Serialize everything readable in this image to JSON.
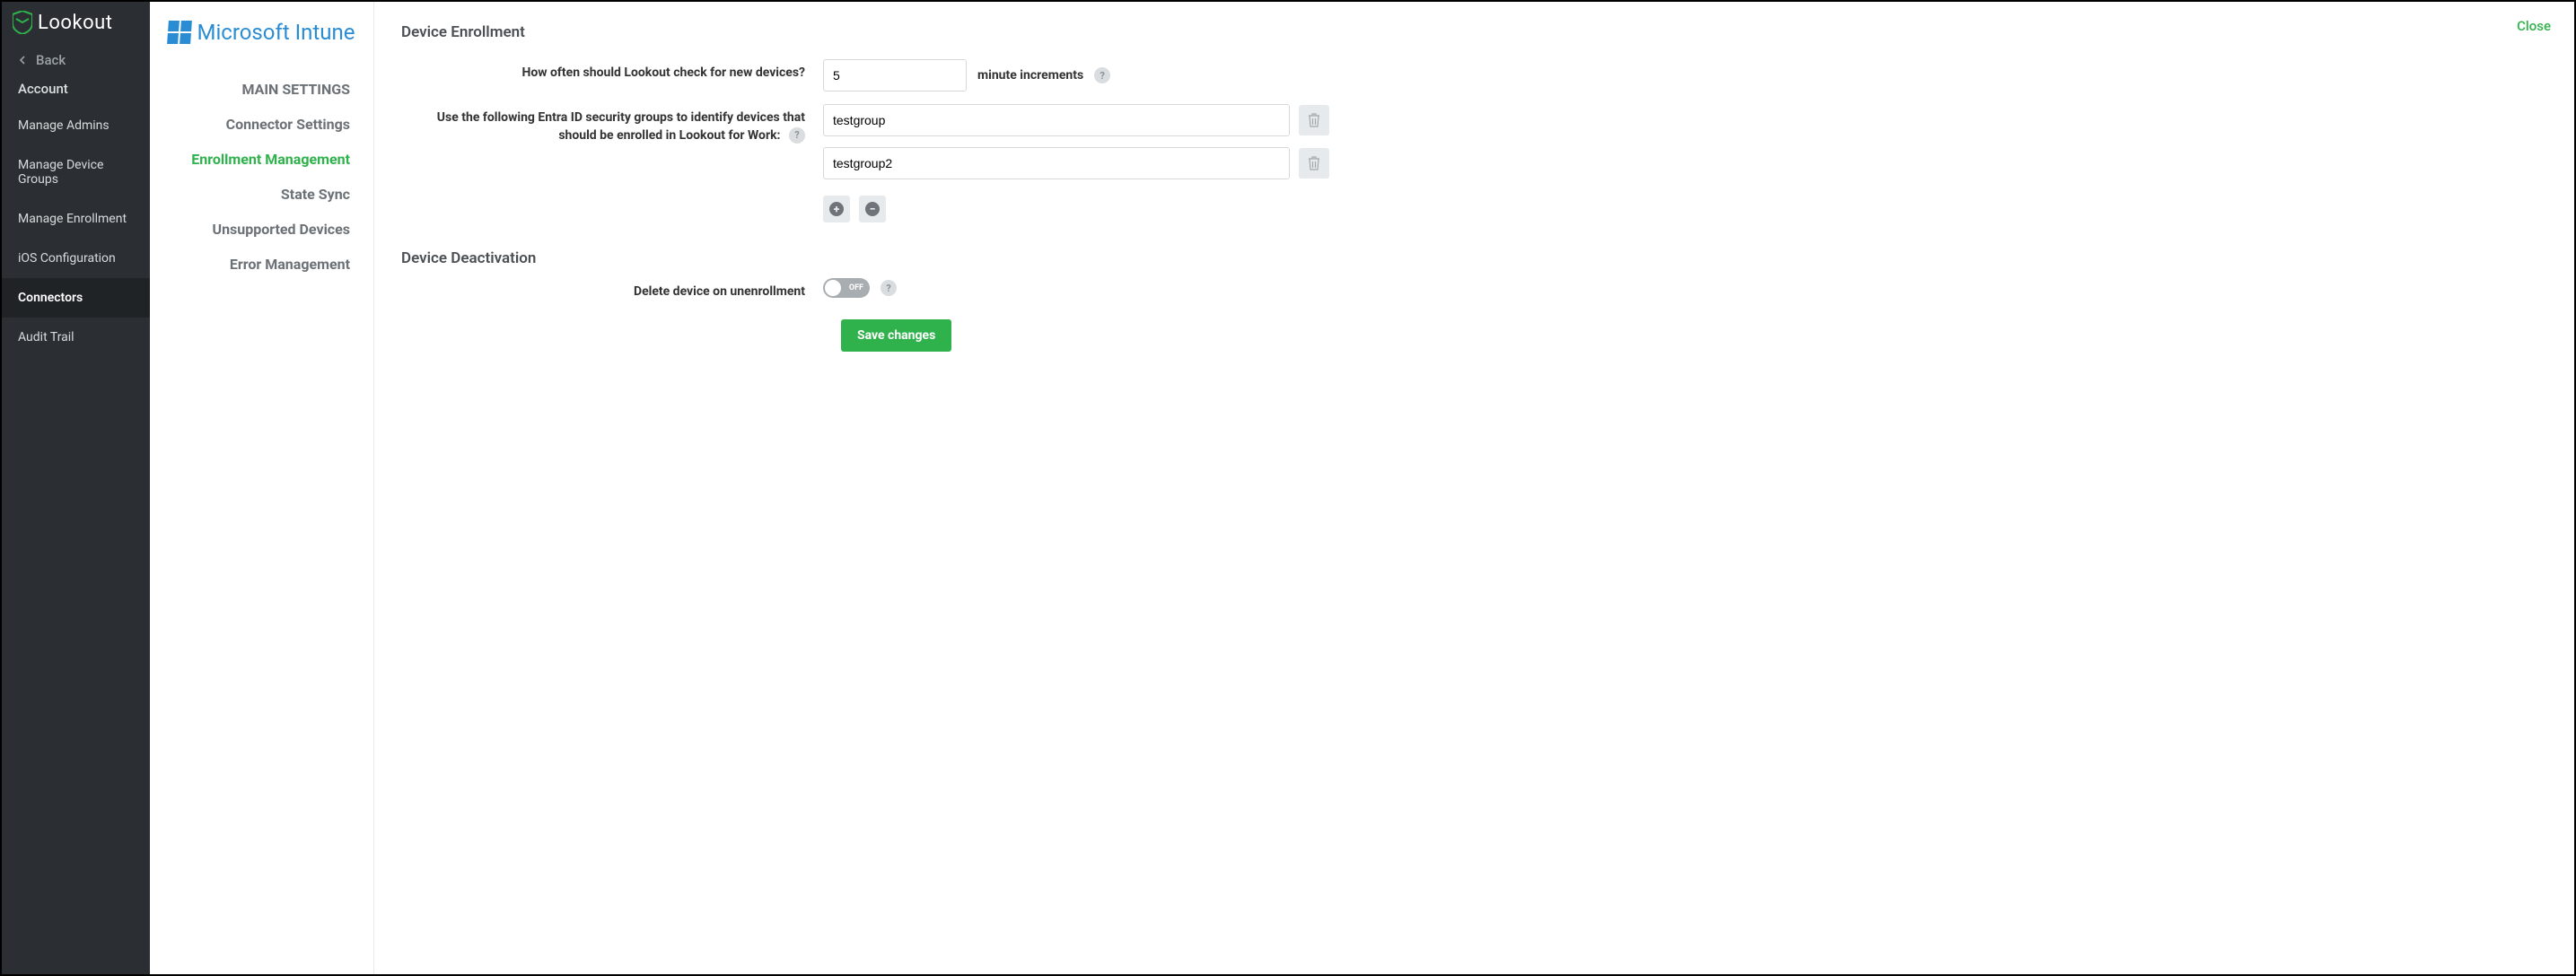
{
  "brand": "Lookout",
  "sidebar": {
    "back": "Back",
    "account": "Account",
    "items": [
      {
        "label": "Manage Admins",
        "active": false
      },
      {
        "label": "Manage Device Groups",
        "active": false
      },
      {
        "label": "Manage Enrollment",
        "active": false
      },
      {
        "label": "iOS Configuration",
        "active": false
      },
      {
        "label": "Connectors",
        "active": true
      },
      {
        "label": "Audit Trail",
        "active": false
      }
    ]
  },
  "subnav": {
    "brand": "Microsoft Intune",
    "items": [
      {
        "label": "MAIN SETTINGS",
        "active": false
      },
      {
        "label": "Connector Settings",
        "active": false
      },
      {
        "label": "Enrollment Management",
        "active": true
      },
      {
        "label": "State Sync",
        "active": false
      },
      {
        "label": "Unsupported Devices",
        "active": false
      },
      {
        "label": "Error Management",
        "active": false
      }
    ]
  },
  "header": {
    "close": "Close"
  },
  "enrollment": {
    "title": "Device Enrollment",
    "freq_label": "How often should Lookout check for new devices?",
    "freq_value": "5",
    "freq_suffix": "minute increments",
    "groups_label_pre": "Use the following ",
    "groups_label_entra": "Entra ID",
    "groups_label_post": " security groups to identify devices that should be enrolled in Lookout for Work:",
    "groups": [
      "testgroup",
      "testgroup2"
    ]
  },
  "deactivation": {
    "title": "Device Deactivation",
    "delete_label": "Delete device on unenrollment",
    "toggle_state": "OFF"
  },
  "actions": {
    "save": "Save changes"
  }
}
